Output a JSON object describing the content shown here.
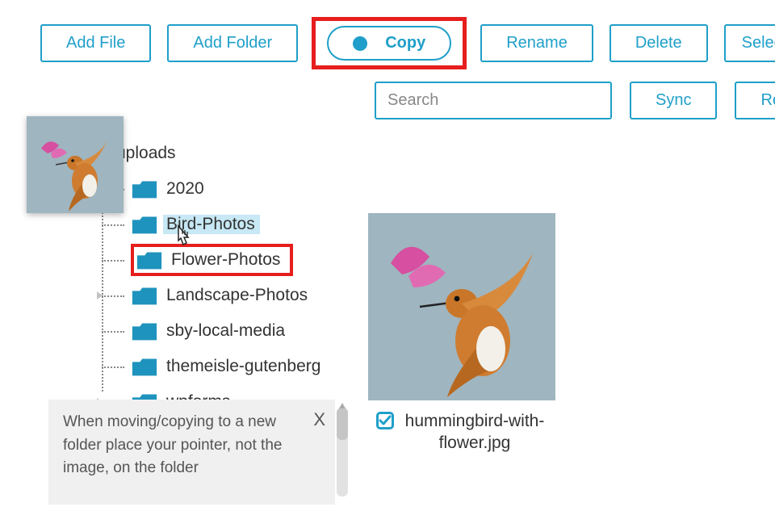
{
  "toolbar": {
    "add_file": "Add File",
    "add_folder": "Add Folder",
    "copy": "Copy",
    "rename": "Rename",
    "delete": "Delete",
    "select_unselect": "Select/Uns"
  },
  "search": {
    "placeholder": "Search"
  },
  "actions": {
    "sync": "Sync",
    "regenerate": "Regene"
  },
  "tree": {
    "root": "uploads",
    "children": [
      {
        "label": "2020"
      },
      {
        "label": "Bird-Photos",
        "selected": true
      },
      {
        "label": "Flower-Photos",
        "highlighted": true
      },
      {
        "label": "Landscape-Photos"
      },
      {
        "label": "sby-local-media"
      },
      {
        "label": "themeisle-gutenberg"
      },
      {
        "label": "wpforms"
      }
    ]
  },
  "file": {
    "name": "hummingbird-with-flower.jpg",
    "checked": true
  },
  "help": {
    "close": "X",
    "text": "When moving/copying to a new folder place your pointer, not the image, on the folder"
  },
  "colors": {
    "accent": "#1f9fc9",
    "danger": "#e61e1e"
  }
}
